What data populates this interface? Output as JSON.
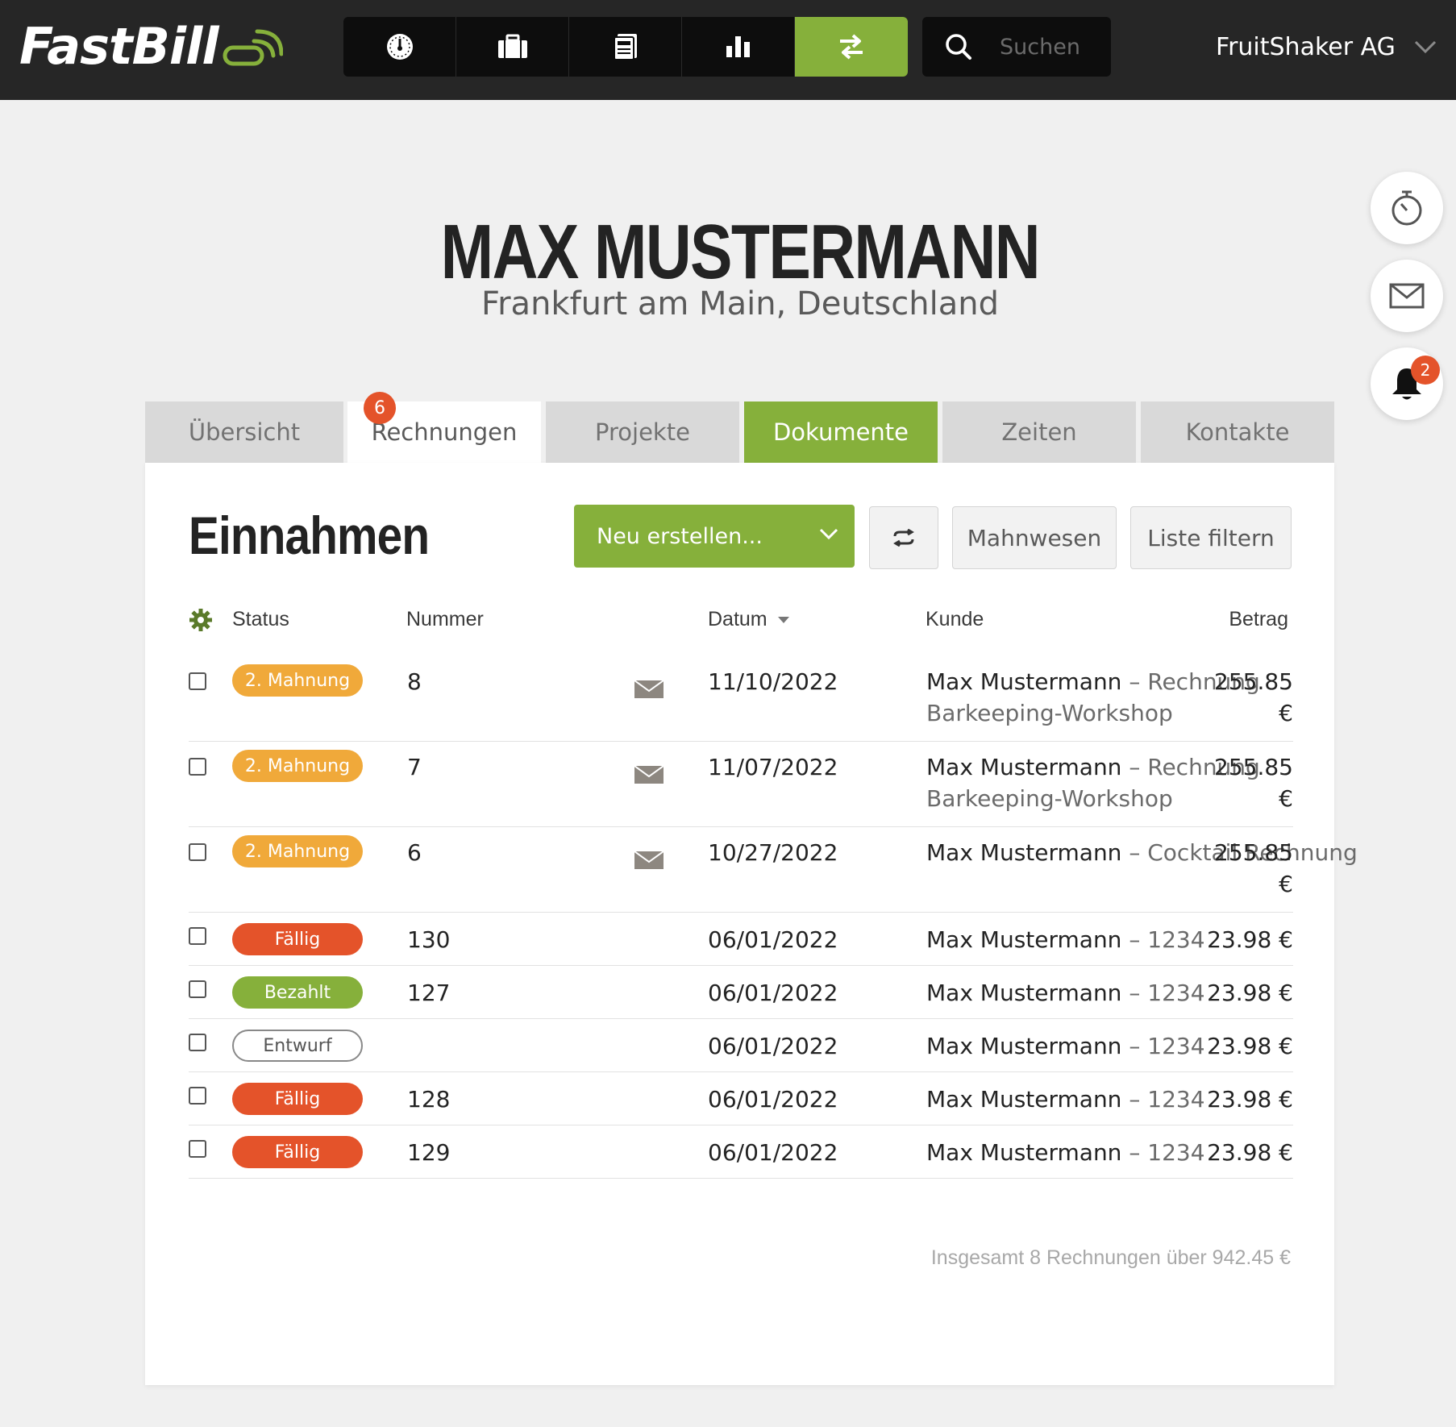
{
  "app": {
    "logo_text": "FastBill",
    "search_placeholder": "Suchen",
    "company": "FruitShaker AG",
    "nav": [
      {
        "icon": "dashboard-icon"
      },
      {
        "icon": "briefcase-icon"
      },
      {
        "icon": "document-icon"
      },
      {
        "icon": "chart-icon"
      },
      {
        "icon": "transfer-icon",
        "active": true
      }
    ]
  },
  "header": {
    "name": "MAX MUSTERMANN",
    "location": "Frankfurt am Main, Deutschland"
  },
  "fab": {
    "bell_badge": "2"
  },
  "tabs": [
    {
      "label": "Übersicht"
    },
    {
      "label": "Rechnungen",
      "badge": "6",
      "selected": true
    },
    {
      "label": "Projekte"
    },
    {
      "label": "Dokumente",
      "highlight": true
    },
    {
      "label": "Zeiten"
    },
    {
      "label": "Kontakte"
    }
  ],
  "card": {
    "title": "Einnahmen",
    "new_button": "Neu erstellen...",
    "dunning_button": "Mahnwesen",
    "filter_button": "Liste filtern"
  },
  "table": {
    "headers": {
      "status": "Status",
      "number": "Nummer",
      "date": "Datum",
      "customer": "Kunde",
      "amount": "Betrag"
    },
    "rows": [
      {
        "status": "2. Mahnung",
        "status_type": "mahnung",
        "number": "8",
        "mail": true,
        "date": "11/10/2022",
        "customer": "Max Mustermann",
        "desc": "Rechnung Barkeeping-Workshop",
        "amount": "255.85 €"
      },
      {
        "status": "2. Mahnung",
        "status_type": "mahnung",
        "number": "7",
        "mail": true,
        "date": "11/07/2022",
        "customer": "Max Mustermann",
        "desc": "Rechnung Barkeeping-Workshop",
        "amount": "255.85 €"
      },
      {
        "status": "2. Mahnung",
        "status_type": "mahnung",
        "number": "6",
        "mail": true,
        "date": "10/27/2022",
        "customer": "Max Mustermann",
        "desc": "Cocktail Rechnung",
        "amount": "255.85 €"
      },
      {
        "status": "Fällig",
        "status_type": "faellig",
        "number": "130",
        "mail": false,
        "date": "06/01/2022",
        "customer": "Max Mustermann",
        "desc": "1234",
        "amount": "23.98 €"
      },
      {
        "status": "Bezahlt",
        "status_type": "bezahlt",
        "number": "127",
        "mail": false,
        "date": "06/01/2022",
        "customer": "Max Mustermann",
        "desc": "1234",
        "amount": "23.98 €"
      },
      {
        "status": "Entwurf",
        "status_type": "entwurf",
        "number": "",
        "mail": false,
        "date": "06/01/2022",
        "customer": "Max Mustermann",
        "desc": "1234",
        "amount": "23.98 €"
      },
      {
        "status": "Fällig",
        "status_type": "faellig",
        "number": "128",
        "mail": false,
        "date": "06/01/2022",
        "customer": "Max Mustermann",
        "desc": "1234",
        "amount": "23.98 €"
      },
      {
        "status": "Fällig",
        "status_type": "faellig",
        "number": "129",
        "mail": false,
        "date": "06/01/2022",
        "customer": "Max Mustermann",
        "desc": "1234",
        "amount": "23.98 €"
      }
    ],
    "total": "Insgesamt 8 Rechnungen über 942.45 €"
  },
  "colors": {
    "brand_green": "#86b03b",
    "alert_orange": "#e4532a",
    "warning_amber": "#f0a93a",
    "topbar": "#262626"
  }
}
